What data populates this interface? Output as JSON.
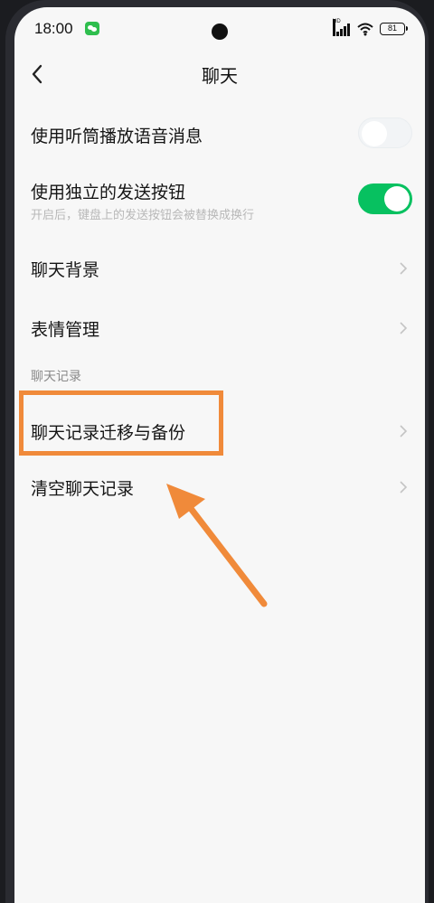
{
  "status_bar": {
    "time": "18:00",
    "app_icon": "wechat-icon",
    "signal_label": "HD",
    "battery_level": "81"
  },
  "nav": {
    "back_icon": "back-arrow-icon",
    "title": "聊天"
  },
  "settings": {
    "earpiece_playback": {
      "label": "使用听筒播放语音消息",
      "enabled": false
    },
    "separate_send_button": {
      "label": "使用独立的发送按钮",
      "description": "开启后，键盘上的发送按钮会被替换成换行",
      "enabled": true
    },
    "chat_background": {
      "label": "聊天背景"
    },
    "sticker_management": {
      "label": "表情管理"
    },
    "chat_history_section": {
      "header": "聊天记录"
    },
    "history_migrate_backup": {
      "label": "聊天记录迁移与备份"
    },
    "clear_history": {
      "label": "清空聊天记录"
    }
  },
  "annotation": {
    "highlight_color": "#f08a3a",
    "arrow_color": "#f08a3a"
  },
  "colors": {
    "toggle_on": "#07c160",
    "background": "#f7f7f7"
  }
}
